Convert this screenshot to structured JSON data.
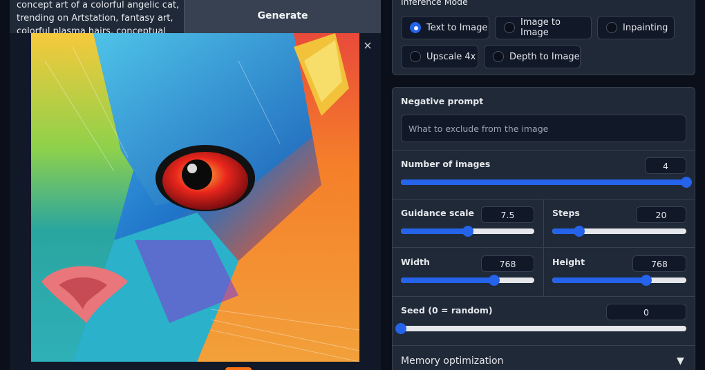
{
  "prompt": {
    "lines": [
      "concept art of a colorful angelic cat,",
      "trending on Artstation, fantasy art,",
      "colorful plasma hairs, conceptual"
    ]
  },
  "generate_label": "Generate",
  "gallery": {
    "close_symbol": "×"
  },
  "inference": {
    "label": "Inference Mode",
    "options": [
      "Text to Image",
      "Image to Image",
      "Inpainting",
      "Upscale 4x",
      "Depth to Image"
    ],
    "selected": "Text to Image"
  },
  "negative_prompt": {
    "label": "Negative prompt",
    "placeholder": "What to exclude from the image"
  },
  "num_images": {
    "label": "Number of images",
    "value": "4",
    "fraction": 1.0
  },
  "guidance": {
    "label": "Guidance scale",
    "value": "7.5",
    "fraction": 0.5
  },
  "steps": {
    "label": "Steps",
    "value": "20",
    "fraction": 0.2
  },
  "width": {
    "label": "Width",
    "value": "768",
    "fraction": 0.7
  },
  "height": {
    "label": "Height",
    "value": "768",
    "fraction": 0.7
  },
  "seed": {
    "label": "Seed (0 = random)",
    "value": "0",
    "fraction": 0.0
  },
  "memory": {
    "label": "Memory optimization",
    "icon": "triangle-down-icon"
  },
  "colors": {
    "accent": "#2563eb",
    "background": "#0b0f19",
    "panel": "#1f2937",
    "orange": "#f97316"
  }
}
